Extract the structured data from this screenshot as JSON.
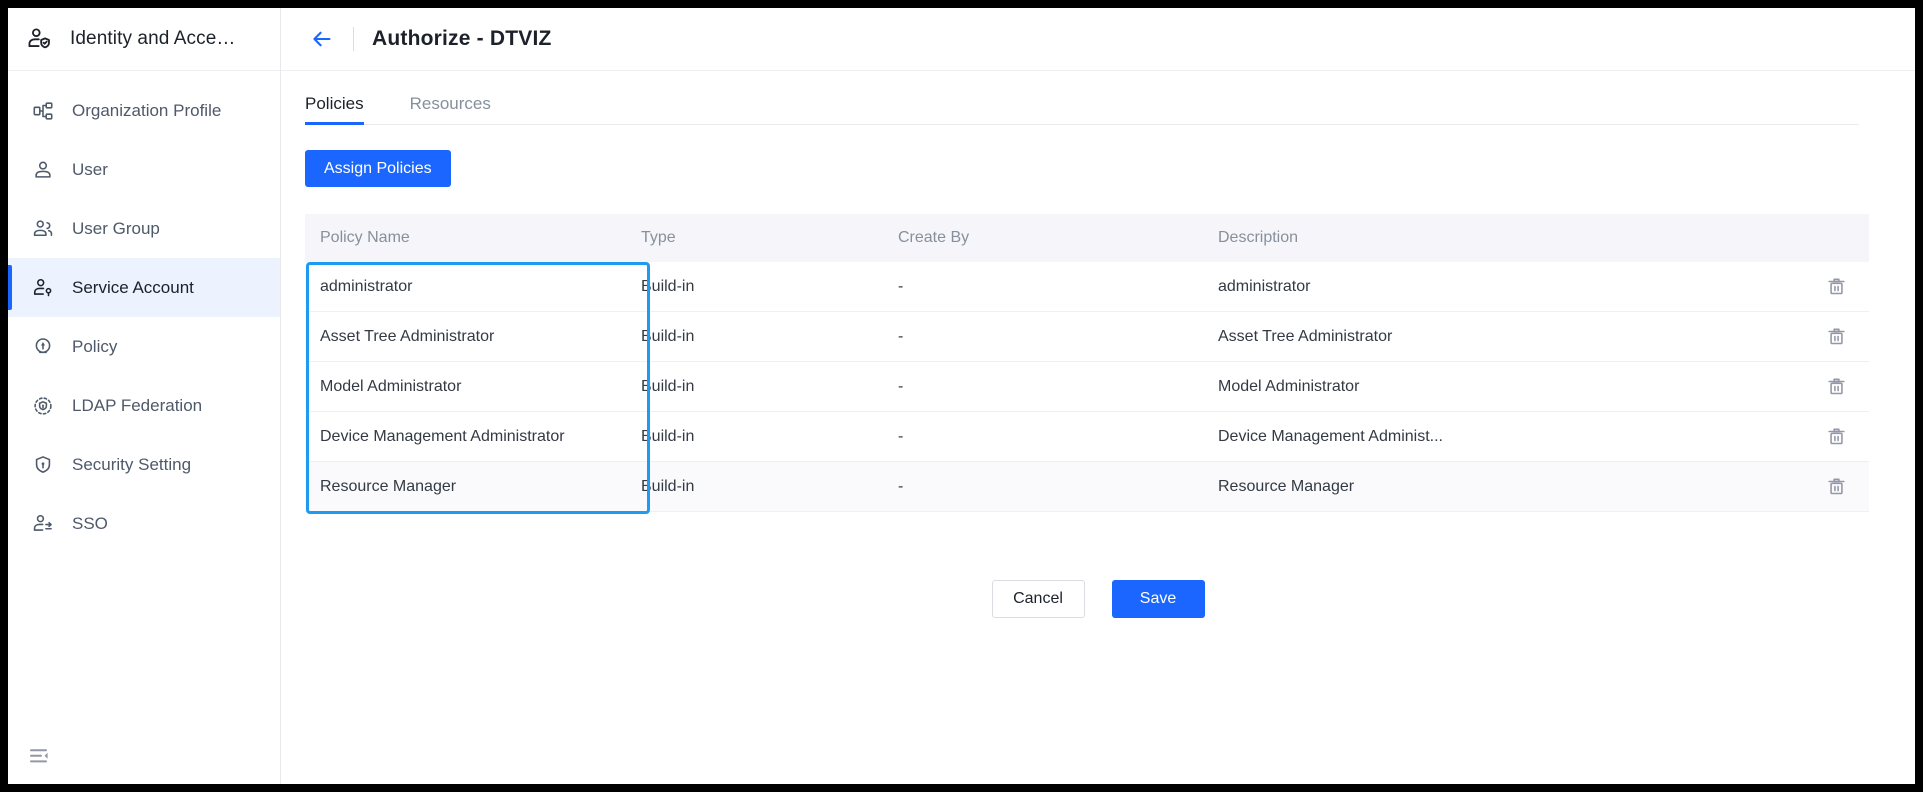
{
  "sidebar": {
    "header": {
      "title": "Identity and Acce…",
      "icon": "user-shield-icon"
    },
    "items": [
      {
        "label": "Organization Profile",
        "icon": "org-chart-icon",
        "active": false
      },
      {
        "label": "User",
        "icon": "user-icon",
        "active": false
      },
      {
        "label": "User Group",
        "icon": "users-icon",
        "active": false
      },
      {
        "label": "Service Account",
        "icon": "service-account-icon",
        "active": true
      },
      {
        "label": "Policy",
        "icon": "policy-icon",
        "active": false
      },
      {
        "label": "LDAP Federation",
        "icon": "ldap-federation-icon",
        "active": false
      },
      {
        "label": "Security Setting",
        "icon": "shield-lock-icon",
        "active": false
      },
      {
        "label": "SSO",
        "icon": "sso-icon",
        "active": false
      }
    ],
    "collapse_icon": "sidebar-collapse-icon"
  },
  "header": {
    "back_icon": "arrow-left-icon",
    "title": "Authorize - DTVIZ"
  },
  "tabs": [
    {
      "label": "Policies",
      "active": true
    },
    {
      "label": "Resources",
      "active": false
    }
  ],
  "toolbar": {
    "assign_label": "Assign Policies"
  },
  "table": {
    "columns": [
      "Policy Name",
      "Type",
      "Create By",
      "Description"
    ],
    "action_icon": "trash-icon",
    "rows": [
      {
        "name": "administrator",
        "type": "Build-in",
        "create_by": "-",
        "description": "administrator",
        "hovered": false
      },
      {
        "name": "Asset Tree Administrator",
        "type": "Build-in",
        "create_by": "-",
        "description": "Asset Tree Administrator",
        "hovered": false
      },
      {
        "name": "Model Administrator",
        "type": "Build-in",
        "create_by": "-",
        "description": "Model Administrator",
        "hovered": false
      },
      {
        "name": "Device Management Administrator",
        "type": "Build-in",
        "create_by": "-",
        "description": "Device Management Administ...",
        "hovered": false
      },
      {
        "name": "Resource Manager",
        "type": "Build-in",
        "create_by": "-",
        "description": "Resource Manager",
        "hovered": true
      }
    ]
  },
  "footer": {
    "cancel_label": "Cancel",
    "save_label": "Save"
  },
  "colors": {
    "accent": "#1a66ff",
    "selection_border": "#1e9bf0",
    "active_nav_bg": "#ecf3ff",
    "header_bg": "#f6f6fa",
    "text_primary": "#1d2129",
    "text_muted": "#86909c"
  }
}
